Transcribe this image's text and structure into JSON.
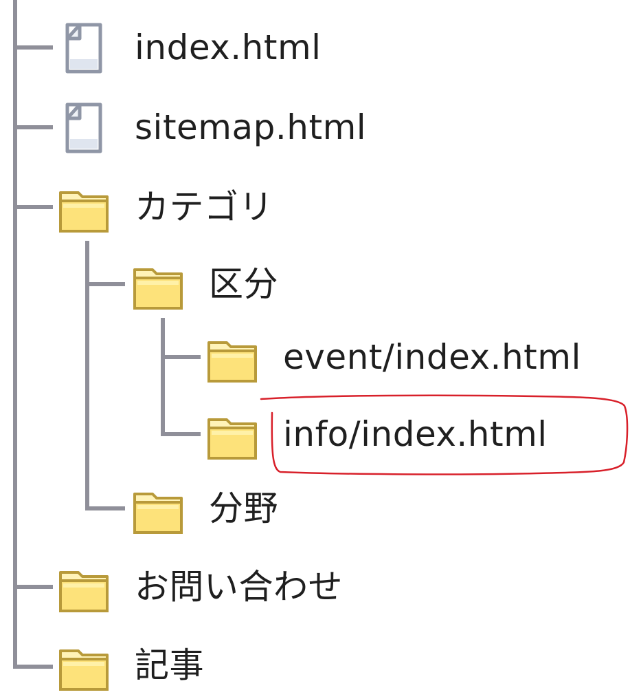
{
  "tree": {
    "nodes": [
      {
        "label": "index.html",
        "icon": "file-icon"
      },
      {
        "label": "sitemap.html",
        "icon": "file-icon"
      },
      {
        "label": "カテゴリ",
        "icon": "folder-icon"
      },
      {
        "label": "区分",
        "icon": "folder-icon"
      },
      {
        "label": "event/index.html",
        "icon": "folder-icon"
      },
      {
        "label": "info/index.html",
        "icon": "folder-icon",
        "highlighted": true
      },
      {
        "label": "分野",
        "icon": "folder-icon"
      },
      {
        "label": "お問い合わせ",
        "icon": "folder-icon"
      },
      {
        "label": "記事",
        "icon": "folder-icon"
      }
    ]
  },
  "colors": {
    "connector": "#8f8f99",
    "folder_fill": "#fde27a",
    "folder_stroke": "#b89a3a",
    "highlight": "#d8202a",
    "text": "#1f1f1f"
  }
}
